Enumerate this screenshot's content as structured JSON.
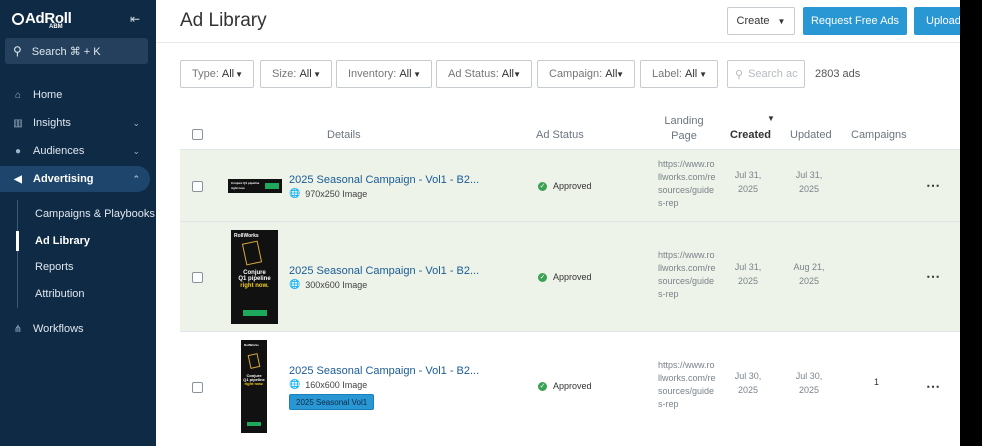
{
  "sidebar": {
    "logo_text": "AdRoll",
    "logo_sub": "ABM",
    "search_placeholder": "Search ⌘ + K",
    "items": [
      {
        "label": "Home"
      },
      {
        "label": "Insights"
      },
      {
        "label": "Audiences"
      },
      {
        "label": "Advertising"
      },
      {
        "label": "Workflows"
      }
    ],
    "sub_items": [
      {
        "label": "Campaigns & Playbooks"
      },
      {
        "label": "Ad Library"
      },
      {
        "label": "Reports"
      },
      {
        "label": "Attribution"
      }
    ]
  },
  "header": {
    "title": "Ad Library",
    "create_label": "Create",
    "request_label": "Request Free Ads",
    "upload_label": "Upload"
  },
  "filters": [
    {
      "name": "Type:",
      "value": "All"
    },
    {
      "name": "Size:",
      "value": "All"
    },
    {
      "name": "Inventory:",
      "value": "All"
    },
    {
      "name": "Ad Status:",
      "value": "All"
    },
    {
      "name": "Campaign:",
      "value": "All"
    },
    {
      "name": "Label:",
      "value": "All"
    }
  ],
  "search_placeholder": "Search ac",
  "ad_count": "2803 ads",
  "columns": {
    "details": "Details",
    "ad_status": "Ad Status",
    "landing_page": "Landing Page",
    "created": "Created",
    "updated": "Updated",
    "campaigns": "Campaigns"
  },
  "rows": [
    {
      "name": "2025 Seasonal Campaign - Vol1 - B2...",
      "size": "970x250 Image",
      "status": "Approved",
      "landing": "https://www.rollworks.com/resources/guides-rep",
      "created": "Jul 31, 2025",
      "updated": "Jul 31, 2025",
      "campaigns": ""
    },
    {
      "name": "2025 Seasonal Campaign - Vol1 - B2...",
      "size": "300x600 Image",
      "status": "Approved",
      "landing": "https://www.rollworks.com/resources/guides-rep",
      "created": "Jul 31, 2025",
      "updated": "Aug 21, 2025",
      "campaigns": ""
    },
    {
      "name": "2025 Seasonal Campaign - Vol1 - B2...",
      "size": "160x600 Image",
      "status": "Approved",
      "landing": "https://www.rollworks.com/resources/guides-rep",
      "created": "Jul 30, 2025",
      "updated": "Jul 30, 2025",
      "campaigns": "1",
      "label": "2025 Seasonal Vol1"
    }
  ],
  "thumbnails": {
    "brand": "RollWorks",
    "headline_1": "Conjure",
    "headline_2": "Q1 pipeline",
    "headline_3": "right now.",
    "wide_text": "Conjure Q1 pipeline right now."
  },
  "colors": {
    "sidebar_bg": "#0f2a44",
    "accent": "#2a97d5",
    "approved": "#3aa254",
    "row_highlight": "#edf3e8"
  }
}
